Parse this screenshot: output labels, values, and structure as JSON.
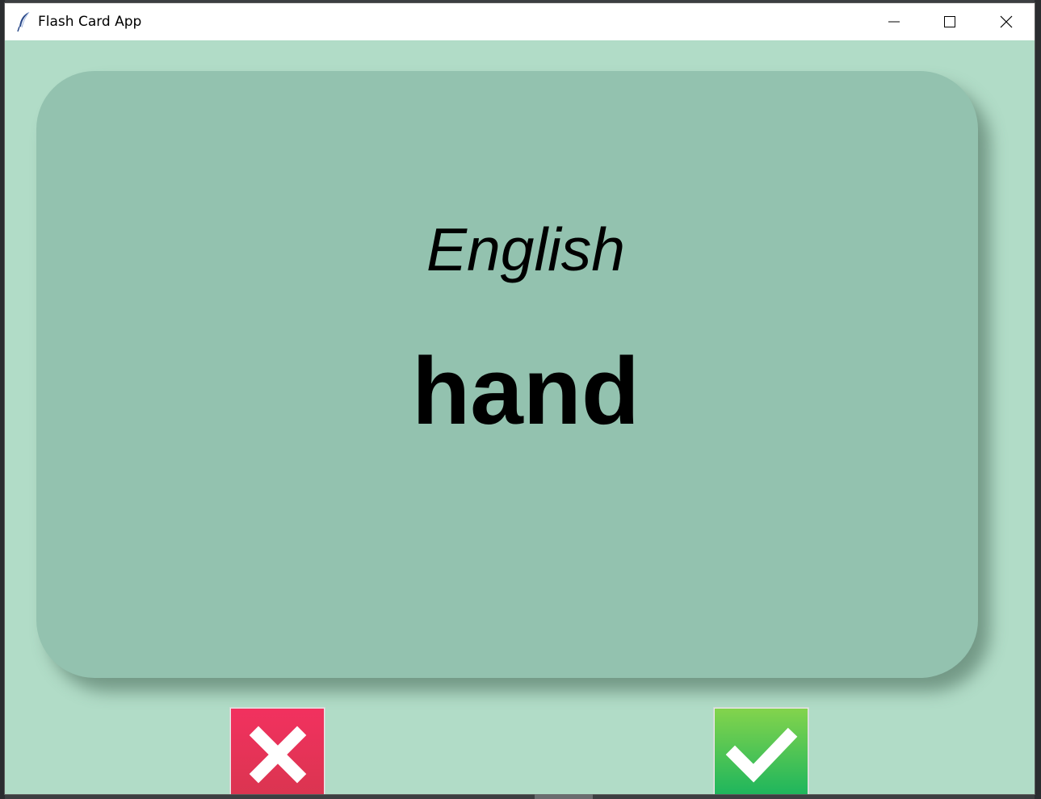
{
  "window": {
    "title": "Flash Card App",
    "icon": "feather-icon"
  },
  "titlebar_buttons": {
    "minimize": "minimize-icon",
    "maximize": "maximize-icon",
    "close": "close-icon"
  },
  "card": {
    "language": "English",
    "word": "hand",
    "background": "#93c2af"
  },
  "answer_buttons": {
    "wrong": {
      "icon": "cross-icon",
      "color": "#e0334f"
    },
    "right": {
      "icon": "checkmark-icon",
      "color": "#3bbf55"
    }
  },
  "colors": {
    "window_background": "#b1dcc7",
    "card": "#93c2af"
  }
}
